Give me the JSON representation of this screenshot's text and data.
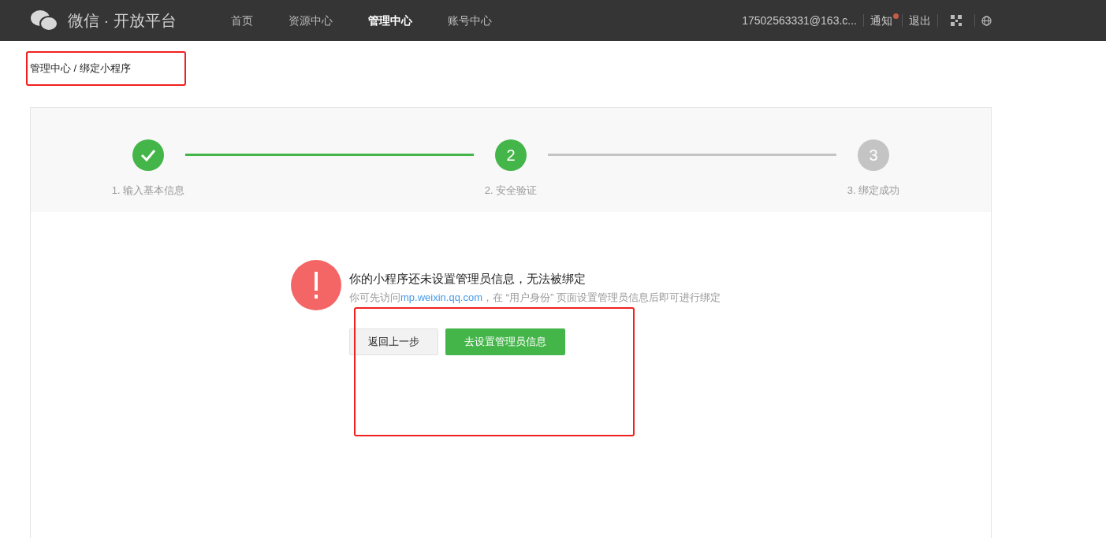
{
  "header": {
    "logo_text": "微信 · 开放平台",
    "nav": [
      {
        "label": "首页",
        "selected": false
      },
      {
        "label": "资源中心",
        "selected": false
      },
      {
        "label": "管理中心",
        "selected": true
      },
      {
        "label": "账号中心",
        "selected": false
      }
    ],
    "account": "17502563331@163.c...",
    "notice": {
      "label": "通知",
      "unread": true
    },
    "logout": "退出"
  },
  "breadcrumb": "管理中心 / 绑定小程序",
  "steps": [
    {
      "label": "1. 输入基本信息",
      "completed": true,
      "reached": true
    },
    {
      "number": "2",
      "label": "2. 安全验证",
      "completed": false,
      "reached": true
    },
    {
      "number": "3",
      "label": "3. 绑定成功",
      "completed": false,
      "reached": false
    }
  ],
  "message": {
    "title": "你的小程序还未设置管理员信息，无法被绑定",
    "hint_before": "你可先访问",
    "hint_link": "mp.weixin.qq.com",
    "hint_after": "，在 “用户身份” 页面设置管理员信息后即可进行绑定"
  },
  "buttons": [
    {
      "label": "返回上一步",
      "kind": "secondary"
    },
    {
      "label": "去设置管理员信息",
      "kind": "primary"
    }
  ]
}
